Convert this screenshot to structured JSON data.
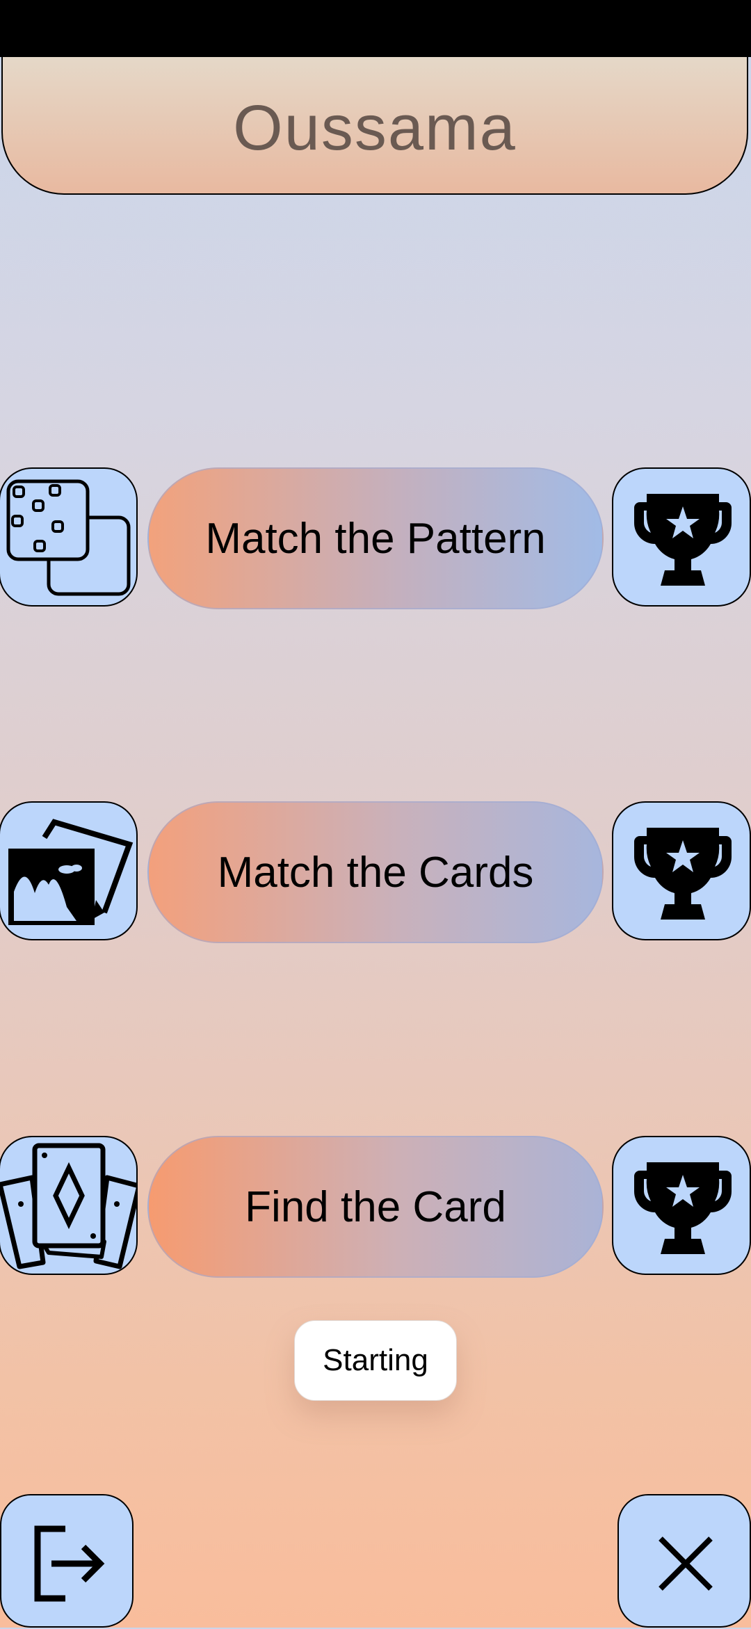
{
  "status_bar": {},
  "header": {
    "title": "Oussama"
  },
  "games": [
    {
      "label": "Match the Pattern",
      "icon": "pattern-dice-icon",
      "trophy": "trophy-icon"
    },
    {
      "label": "Match the Cards",
      "icon": "picture-cards-icon",
      "trophy": "trophy-icon"
    },
    {
      "label": "Find the Card",
      "icon": "playing-cards-icon",
      "trophy": "trophy-icon"
    }
  ],
  "toast": {
    "text": "Starting"
  },
  "bottom": {
    "logout_icon": "logout-icon",
    "close_icon": "close-icon"
  },
  "colors": {
    "icon_bg": "#bcd6fb",
    "header_text": "#6a5a52"
  }
}
